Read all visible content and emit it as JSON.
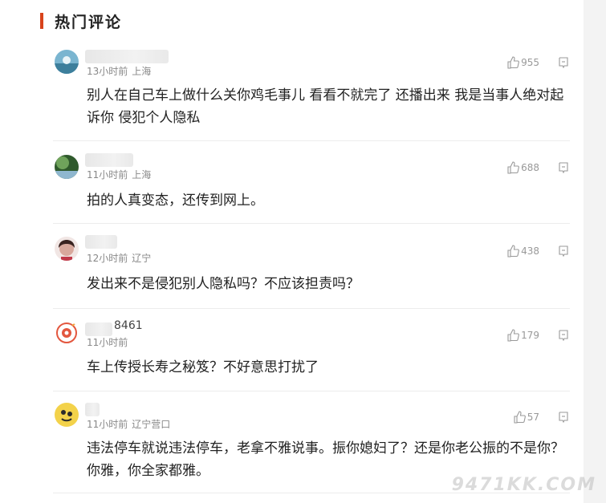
{
  "section_title": "热门评论",
  "comments": [
    {
      "username": "",
      "time": "13小时前",
      "location": "上海",
      "likes": "955",
      "text": "别人在自己车上做什么关你鸡毛事儿 看看不就完了 还播出来 我是当事人绝对起诉你 侵犯个人隐私",
      "avatar_color": "#5a9ab8"
    },
    {
      "username": "",
      "time": "11小时前",
      "location": "上海",
      "likes": "688",
      "text": "拍的人真变态，还传到网上。",
      "avatar_color": "#3f6e3a"
    },
    {
      "username": "",
      "time": "12小时前",
      "location": "辽宁",
      "likes": "438",
      "text": "发出来不是侵犯别人隐私吗？不应该担责吗？",
      "avatar_color": "#c98f8a"
    },
    {
      "username": "8461",
      "time": "11小时前",
      "location": "",
      "likes": "179",
      "text": "车上传授长寿之秘笈？不好意思打扰了",
      "avatar_color": "#e3573f"
    },
    {
      "username": "",
      "time": "11小时前",
      "location": "辽宁营口",
      "likes": "57",
      "text": "违法停车就说违法停车，老拿不雅说事。振你媳妇了？还是你老公振的不是你？你雅，你全家都雅。",
      "avatar_color": "#e0b91c"
    }
  ],
  "watermark": "9471KK.COM",
  "icons": {
    "like": "thumbs-up-icon",
    "reply": "reply-bubble-icon"
  }
}
